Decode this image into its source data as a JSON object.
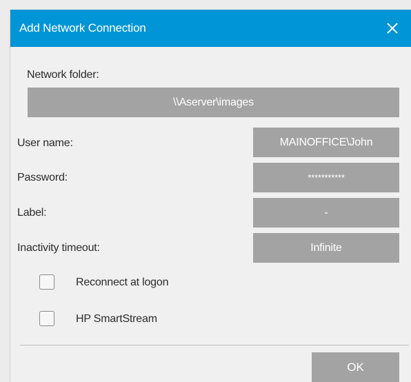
{
  "dialog": {
    "title": "Add Network Connection",
    "close_icon": "close-icon",
    "accent_color": "#0095d6"
  },
  "form": {
    "network_folder_label": "Network folder:",
    "network_folder_value": "\\\\Aserver\\images",
    "user_name_label": "User name:",
    "user_name_value": "MAINOFFICE\\John",
    "password_label": "Password:",
    "password_value": "***********",
    "label_label": "Label:",
    "label_value": "-",
    "inactivity_timeout_label": "Inactivity timeout:",
    "inactivity_timeout_value": "Infinite"
  },
  "options": {
    "reconnect_label": "Reconnect at logon",
    "reconnect_checked": false,
    "smartstream_label": "HP SmartStream",
    "smartstream_checked": false
  },
  "footer": {
    "ok_label": "OK"
  }
}
